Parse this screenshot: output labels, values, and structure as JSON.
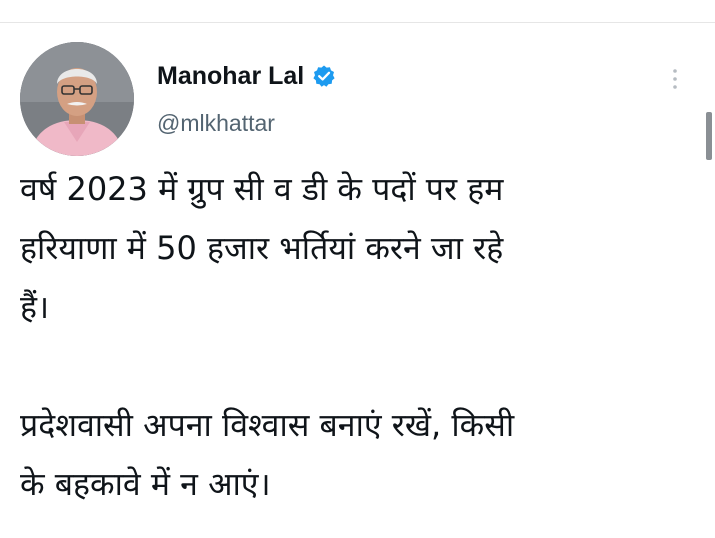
{
  "tweet": {
    "author": {
      "display_name": "Manohar Lal",
      "handle": "@mlkhattar",
      "verified": true,
      "verified_color": "#1d9bf0"
    },
    "text_lines_para1": [
      "वर्ष 2023 में ग्रुप सी व डी के पदों पर हम",
      "हरियाणा में 50 हजार भर्तियां करने जा रहे",
      "हैं।"
    ],
    "text_lines_para2": [
      "प्रदेशवासी अपना विश्वास बनाएं रखें, किसी",
      "के बहकावे में न आएं।"
    ]
  },
  "icons": {
    "verified": "verified-badge-icon",
    "more": "more-options-icon"
  }
}
